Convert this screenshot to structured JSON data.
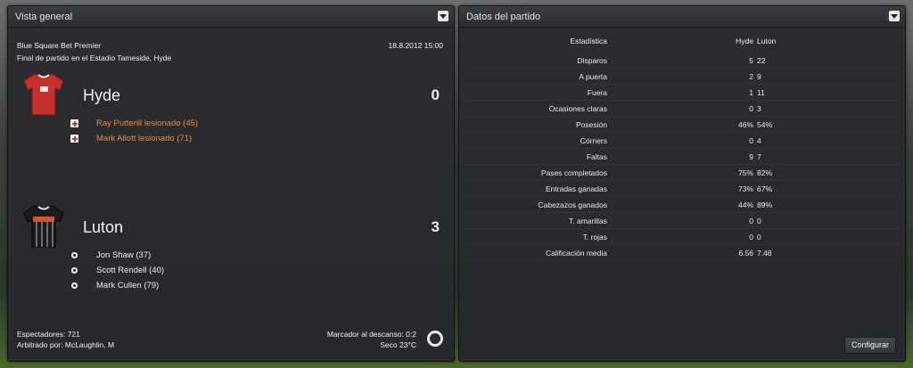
{
  "overview": {
    "title": "Vista general",
    "competition": "Blue Square Bet Premier",
    "datetime": "18.8.2012 15:00",
    "venue": "Final de partido en el Estadio Tameside, Hyde",
    "home": {
      "name": "Hyde",
      "score": "0",
      "events": [
        {
          "type": "injury",
          "text": "Ray Putterill lesionado (45)"
        },
        {
          "type": "injury",
          "text": "Mark Allott lesionado (71)"
        }
      ]
    },
    "away": {
      "name": "Luton",
      "score": "3",
      "events": [
        {
          "type": "goal",
          "text": "Jon Shaw (37)"
        },
        {
          "type": "goal",
          "text": "Scott Rendell (40)"
        },
        {
          "type": "goal",
          "text": "Mark Cullen (79)"
        }
      ]
    },
    "footer": {
      "attendance": "Espectadores: 721",
      "referee": "Arbitrado por: McLaughlin, M",
      "halftime": "Marcador al descanso: 0:2",
      "weather": "Seco 23°C"
    }
  },
  "stats": {
    "title": "Datos del partido",
    "header": {
      "label": "Estadística",
      "home": "Hyde",
      "away": "Luton"
    },
    "rows": [
      {
        "label": "Disparos",
        "home": "5",
        "away": "22"
      },
      {
        "label": "A puerta",
        "home": "2",
        "away": "9"
      },
      {
        "label": "Fuera",
        "home": "1",
        "away": "11"
      },
      {
        "label": "Ocasiones claras",
        "home": "0",
        "away": "3"
      },
      {
        "label": "Posesión",
        "home": "46%",
        "away": "54%"
      },
      {
        "label": "Córners",
        "home": "0",
        "away": "4"
      },
      {
        "label": "Faltas",
        "home": "9",
        "away": "7"
      },
      {
        "label": "Pases completados",
        "home": "75%",
        "away": "82%"
      },
      {
        "label": "Entradas ganadas",
        "home": "73%",
        "away": "67%"
      },
      {
        "label": "Cabezazos ganados",
        "home": "44%",
        "away": "89%"
      },
      {
        "label": "T. amarillas",
        "home": "0",
        "away": "0"
      },
      {
        "label": "T. rojas",
        "home": "0",
        "away": "0"
      },
      {
        "label": "Calificación media",
        "home": "6.56",
        "away": "7.48"
      }
    ],
    "configure_label": "Configurar"
  },
  "colors": {
    "injury": "#f08a3c",
    "home_kit": "#c8302a",
    "away_kit": "#1c1c1f"
  },
  "icons": [
    "chevron-down-icon",
    "home-kit-icon",
    "away-kit-icon",
    "injury-icon",
    "ball-icon",
    "gear-icon"
  ]
}
